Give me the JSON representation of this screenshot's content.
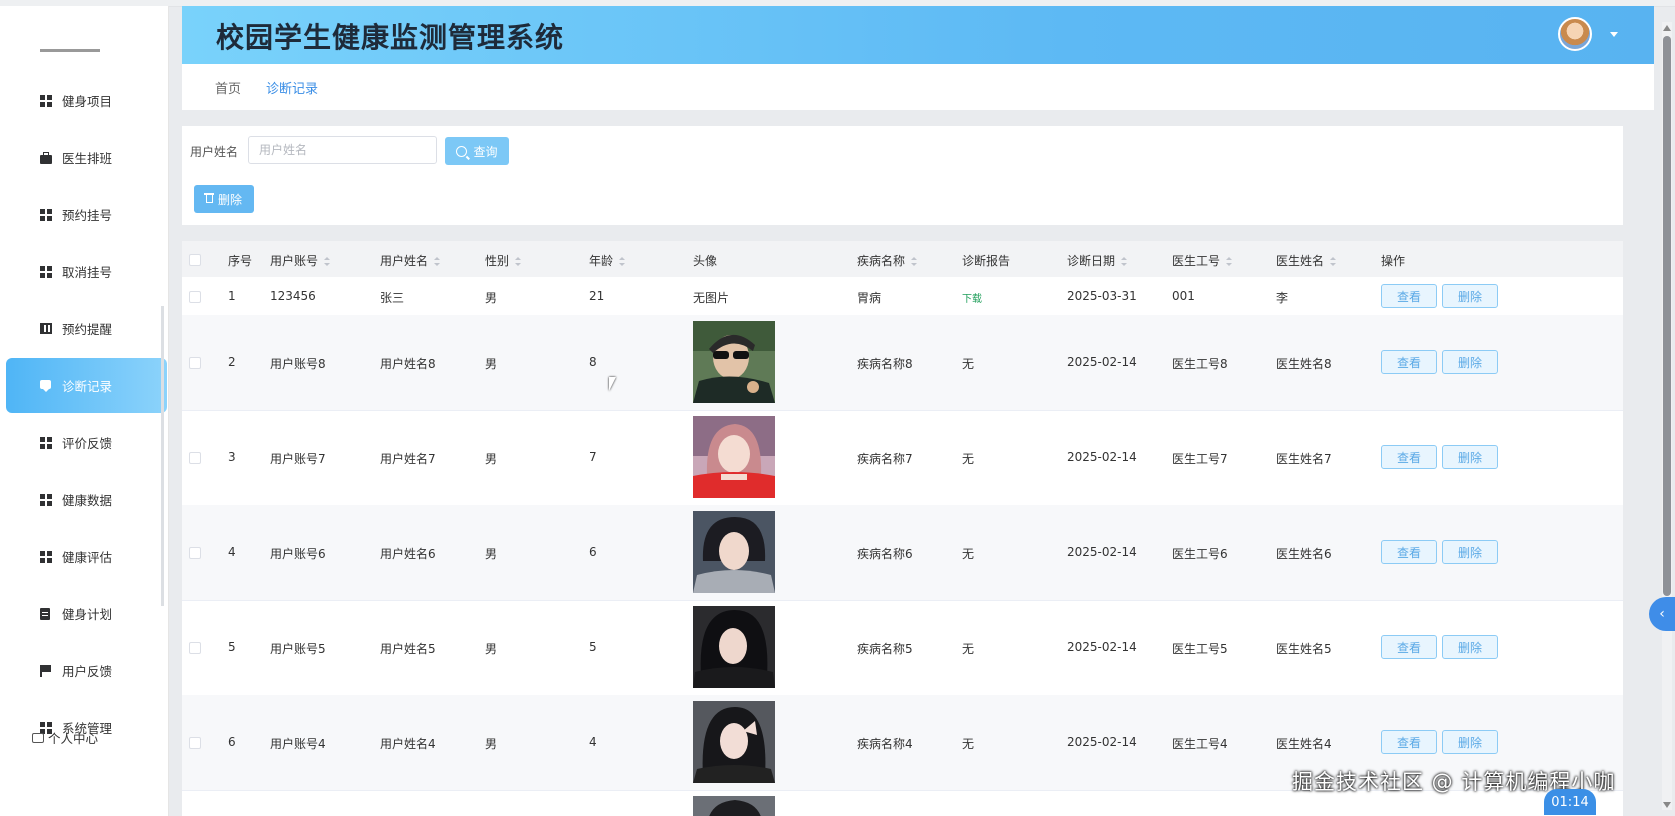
{
  "app": {
    "title": "校园学生健康监测管理系统"
  },
  "sidebar": {
    "items": [
      {
        "label": "健身项目",
        "icon": "grid-icon"
      },
      {
        "label": "医生排班",
        "icon": "briefcase-icon"
      },
      {
        "label": "预约挂号",
        "icon": "grid-icon"
      },
      {
        "label": "取消挂号",
        "icon": "grid-icon"
      },
      {
        "label": "预约提醒",
        "icon": "book-icon"
      },
      {
        "label": "诊断记录",
        "icon": "chat-icon",
        "active": true
      },
      {
        "label": "评价反馈",
        "icon": "grid-icon"
      },
      {
        "label": "健康数据",
        "icon": "grid-icon"
      },
      {
        "label": "健康评估",
        "icon": "grid-icon"
      },
      {
        "label": "健身计划",
        "icon": "clipboard-icon"
      },
      {
        "label": "用户反馈",
        "icon": "flag-icon"
      },
      {
        "label": "系统管理",
        "icon": "grid-icon"
      }
    ],
    "personal": "个人中心"
  },
  "breadcrumb": {
    "home": "首页",
    "current": "诊断记录"
  },
  "search": {
    "label": "用户姓名",
    "placeholder": "用户姓名",
    "value": "",
    "query_button": "查询",
    "delete_button": "删除"
  },
  "table": {
    "headers": {
      "index": "序号",
      "account": "用户账号",
      "name": "用户姓名",
      "gender": "性别",
      "age": "年龄",
      "avatar": "头像",
      "disease": "疾病名称",
      "report": "诊断报告",
      "date": "诊断日期",
      "doctor_id": "医生工号",
      "doctor_name": "医生姓名",
      "actions": "操作"
    },
    "view_label": "查看",
    "delete_label": "删除",
    "rows": [
      {
        "index": "1",
        "account": "123456",
        "name": "张三",
        "gender": "男",
        "age": "21",
        "avatar": "无图片",
        "disease": "胃病",
        "report": "下载",
        "date": "2025-03-31",
        "doctor_id": "001",
        "doctor_name": "李"
      },
      {
        "index": "2",
        "account": "用户账号8",
        "name": "用户姓名8",
        "gender": "男",
        "age": "8",
        "avatar": "",
        "disease": "疾病名称8",
        "report": "无",
        "date": "2025-02-14",
        "doctor_id": "医生工号8",
        "doctor_name": "医生姓名8"
      },
      {
        "index": "3",
        "account": "用户账号7",
        "name": "用户姓名7",
        "gender": "男",
        "age": "7",
        "avatar": "",
        "disease": "疾病名称7",
        "report": "无",
        "date": "2025-02-14",
        "doctor_id": "医生工号7",
        "doctor_name": "医生姓名7"
      },
      {
        "index": "4",
        "account": "用户账号6",
        "name": "用户姓名6",
        "gender": "男",
        "age": "6",
        "avatar": "",
        "disease": "疾病名称6",
        "report": "无",
        "date": "2025-02-14",
        "doctor_id": "医生工号6",
        "doctor_name": "医生姓名6"
      },
      {
        "index": "5",
        "account": "用户账号5",
        "name": "用户姓名5",
        "gender": "男",
        "age": "5",
        "avatar": "",
        "disease": "疾病名称5",
        "report": "无",
        "date": "2025-02-14",
        "doctor_id": "医生工号5",
        "doctor_name": "医生姓名5"
      },
      {
        "index": "6",
        "account": "用户账号4",
        "name": "用户姓名4",
        "gender": "男",
        "age": "4",
        "avatar": "",
        "disease": "疾病名称4",
        "report": "无",
        "date": "2025-02-14",
        "doctor_id": "医生工号4",
        "doctor_name": "医生姓名4"
      }
    ]
  },
  "overlay": {
    "watermark": "掘金技术社区 @ 计算机编程小咖",
    "timer": "01:14"
  },
  "colors": {
    "accent": "#4fb5f6",
    "header_start": "#79d2fb",
    "header_end": "#58b3f1",
    "link": "#3a8ee6",
    "download": "#1f9e5a"
  }
}
